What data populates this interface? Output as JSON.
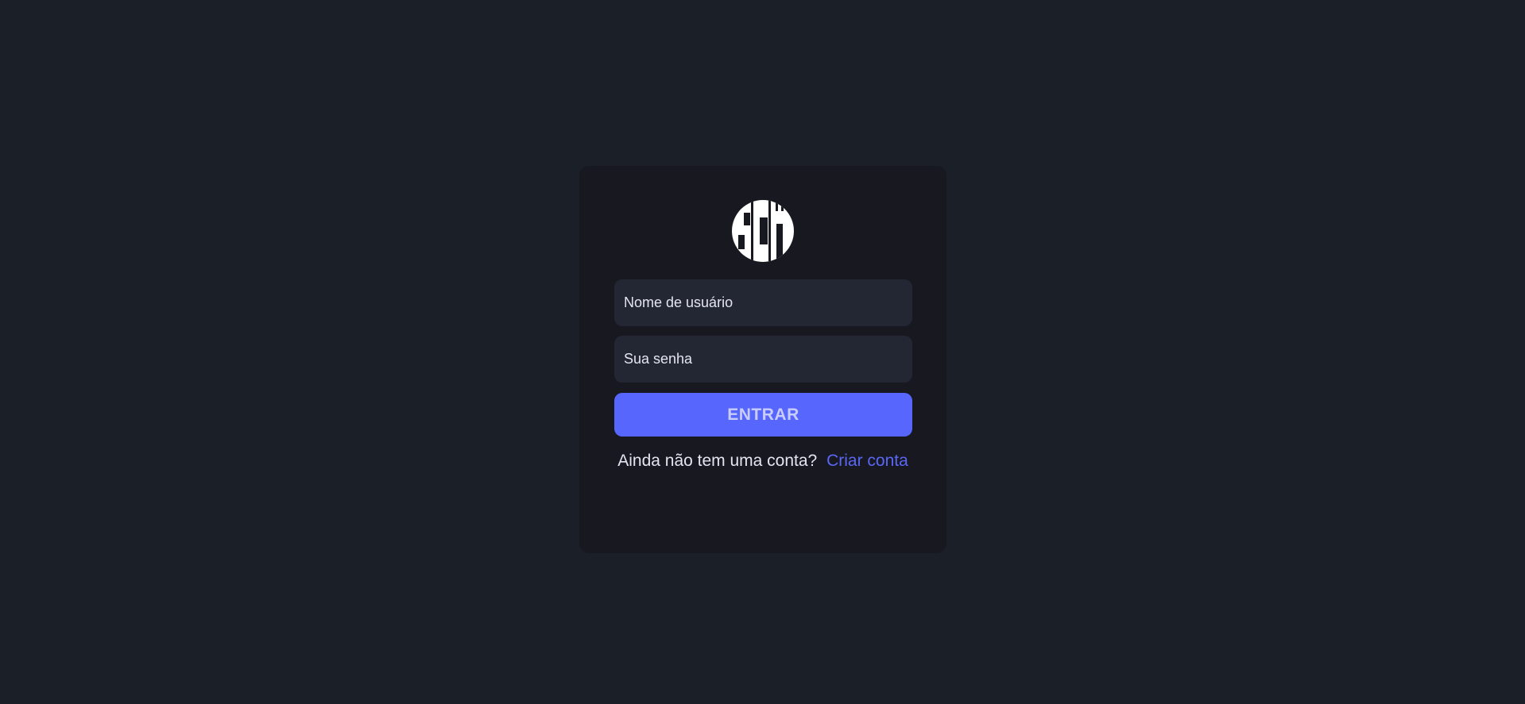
{
  "logo": {
    "text": "SCM",
    "icon": "scm-monogram-logo"
  },
  "form": {
    "username_placeholder": "Nome de usuário",
    "username_value": "",
    "password_placeholder": "Sua senha",
    "password_value": "",
    "submit_label": "ENTRAR"
  },
  "footer": {
    "prompt": "Ainda não tem uma conta?",
    "link_label": "Criar conta"
  },
  "colors": {
    "background": "#1b1f27",
    "card": "#181920",
    "input": "#232734",
    "accent": "#5767fd",
    "link": "#5a66f6",
    "text": "#e4e4f2"
  }
}
